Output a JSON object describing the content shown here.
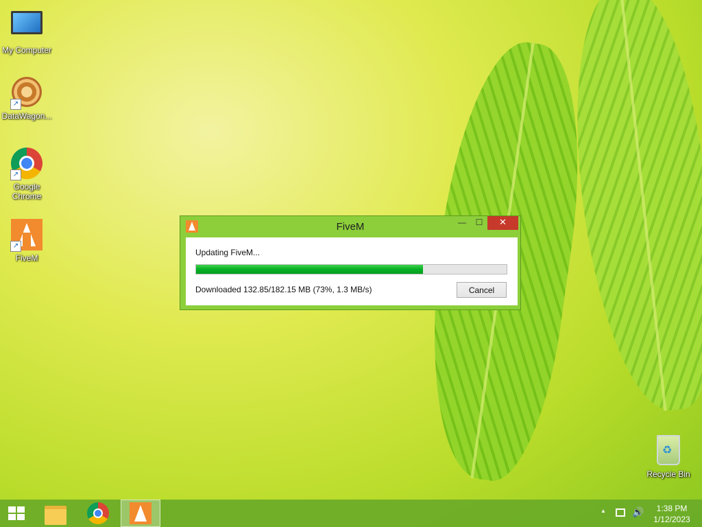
{
  "desktop": {
    "icons": [
      {
        "label": "My Computer",
        "icon": "computer-icon"
      },
      {
        "label": "DataWagon...",
        "icon": "datawagon-icon"
      },
      {
        "label": "Google Chrome",
        "icon": "chrome-icon"
      },
      {
        "label": "FiveM",
        "icon": "fivem-icon"
      },
      {
        "label": "Recycle Bin",
        "icon": "recycle-bin-icon"
      }
    ]
  },
  "dialog": {
    "title": "FiveM",
    "minimize_glyph": "—",
    "maximize_glyph": "☐",
    "close_glyph": "✕",
    "status": "Updating FiveM...",
    "progress_text": "Downloaded 132.85/182.15 MB (73%, 1.3 MB/s)",
    "progress_fraction": 0.73,
    "cancel_label": "Cancel"
  },
  "taskbar": {
    "tray_up_glyph": "▲",
    "volume_glyph": "🔊",
    "time": "1:38 PM",
    "date": "1/12/2023"
  },
  "colors": {
    "progress_fill": "#06b025",
    "close_button": "#c7392b",
    "dialog_frame": "#8ccf3a"
  }
}
